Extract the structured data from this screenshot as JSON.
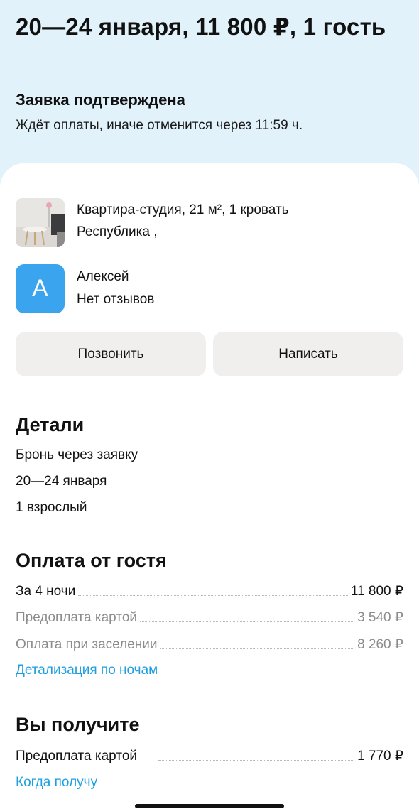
{
  "header": {
    "title": "20—24 января, 11 800 ₽, 1 гость",
    "status": "Заявка подтверждена",
    "status_sub": "Ждёт оплаты, иначе отменится через 11:59 ч."
  },
  "listing": {
    "name": "Квартира-студия, 21 м², 1 кровать",
    "address": "Республика ,"
  },
  "host": {
    "initial": "А",
    "name": "Алексей",
    "reviews": "Нет отзывов"
  },
  "actions": {
    "call": "Позвонить",
    "message": "Написать"
  },
  "details": {
    "heading": "Детали",
    "booking_type": "Бронь через заявку",
    "dates": "20—24 января",
    "guests": "1 взрослый"
  },
  "payment": {
    "heading": "Оплата от гостя",
    "rows": [
      {
        "label": "За 4 ночи",
        "value": "11 800 ₽"
      },
      {
        "label": "Предоплата картой",
        "value": "3 540 ₽"
      },
      {
        "label": "Оплата при заселении",
        "value": "8 260 ₽"
      }
    ],
    "link": "Детализация по ночам"
  },
  "payout": {
    "heading": "Вы получите",
    "row": {
      "label": "Предоплата картой",
      "value": "1 770 ₽"
    },
    "link": "Когда получу"
  },
  "colors": {
    "top_background": "#e2f2fb",
    "accent_link": "#1d9fe0",
    "avatar": "#3aa4ee",
    "button": "#f0efee"
  }
}
